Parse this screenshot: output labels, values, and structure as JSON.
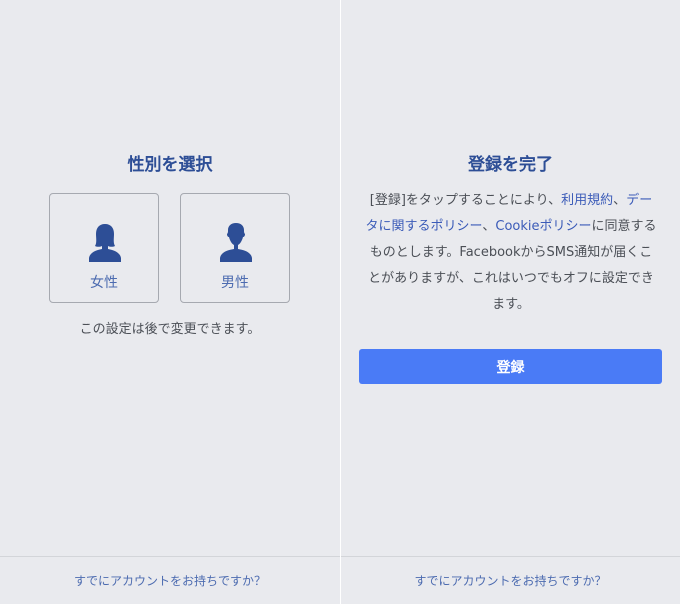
{
  "left_panel": {
    "title": "性別を選択",
    "options": [
      {
        "label": "女性",
        "icon": "female-silhouette-icon"
      },
      {
        "label": "男性",
        "icon": "male-silhouette-icon"
      }
    ],
    "note": "この設定は後で変更できます。",
    "footer_link": "すでにアカウントをお持ちですか？"
  },
  "right_panel": {
    "title": "登録を完了",
    "terms": {
      "part1": "[登録]をタップすることにより、",
      "link_terms": "利用規約",
      "part2": "、",
      "link_data_policy": "データに関するポリシー",
      "part3": "、",
      "link_cookie_policy": "Cookieポリシー",
      "part4": "に同意するものとします。FacebookからSMS通知が届くことがありますが、これはいつでもオフに設定できます。"
    },
    "register_button": "登録",
    "footer_link": "すでにアカウントをお持ちですか？"
  },
  "colors": {
    "background": "#e9eaee",
    "accent": "#4a7bf6",
    "title": "#2d4e96",
    "link": "#3b5bb8",
    "icon": "#2d4e96"
  }
}
